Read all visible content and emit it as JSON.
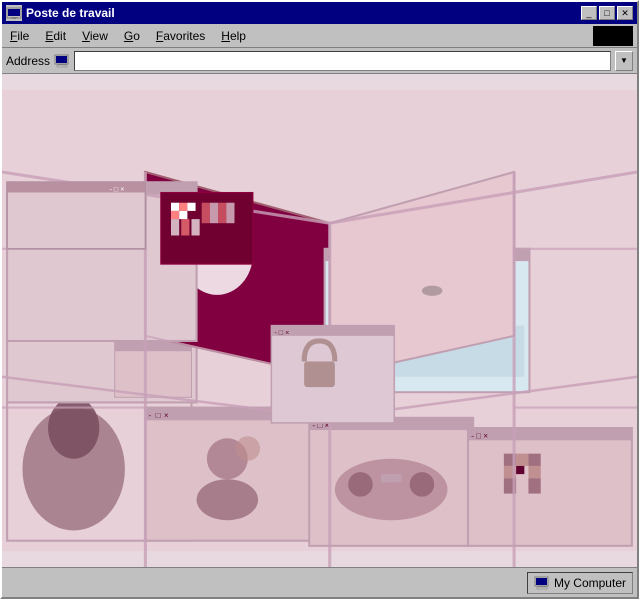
{
  "window": {
    "title": "Poste de travail",
    "icon": "computer-icon"
  },
  "title_buttons": {
    "minimize": "_",
    "maximize": "□",
    "close": "✕"
  },
  "menu": {
    "items": [
      {
        "label": "File",
        "underline_index": 0
      },
      {
        "label": "Edit",
        "underline_index": 0
      },
      {
        "label": "View",
        "underline_index": 0
      },
      {
        "label": "Go",
        "underline_index": 0
      },
      {
        "label": "Favorites",
        "underline_index": 0
      },
      {
        "label": "Help",
        "underline_index": 0
      }
    ]
  },
  "address_bar": {
    "label": "Address"
  },
  "status_bar": {
    "label": "My Computer"
  },
  "colors": {
    "background": "#e8d4dc",
    "window_frame": "#c0c0c0",
    "title_bar": "#000080",
    "panel_pink": "#d4a0b0",
    "panel_dark_pink": "#8b2050",
    "line_color": "#c8a0b0"
  }
}
